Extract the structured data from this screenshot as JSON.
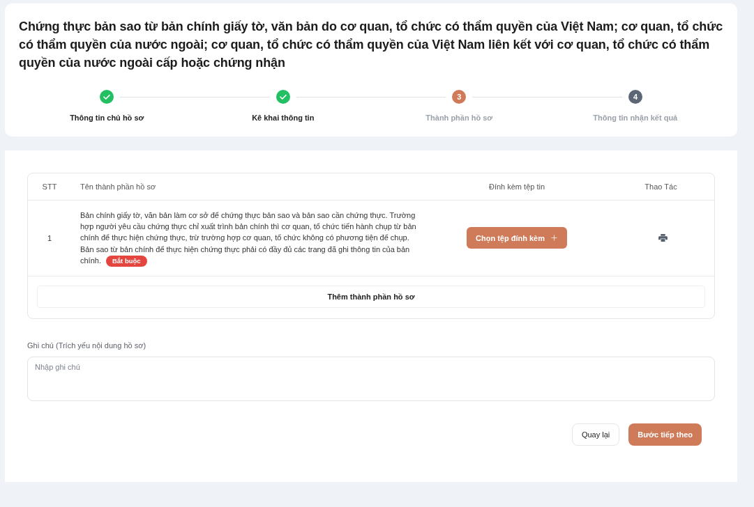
{
  "title": "Chứng thực bản sao từ bản chính giấy tờ, văn bản do cơ quan, tổ chức có thẩm quyền của Việt Nam; cơ quan, tổ chức có thẩm quyền của nước ngoài; cơ quan, tổ chức có thẩm quyền của Việt Nam liên kết với cơ quan, tổ chức có thẩm quyền của nước ngoài cấp hoặc chứng nhận",
  "steps": [
    {
      "label": "Thông tin chủ hồ sơ",
      "done": true,
      "current": false
    },
    {
      "label": "Kê khai thông tin",
      "done": true,
      "current": false
    },
    {
      "label": "Thành phần hồ sơ",
      "done": false,
      "current": true,
      "number": "3"
    },
    {
      "label": "Thông tin nhận kết quả",
      "done": false,
      "current": false,
      "number": "4"
    }
  ],
  "table": {
    "columns": [
      "STT",
      "Tên thành phần hồ sơ",
      "Đính kèm tệp tin",
      "Thao Tác"
    ],
    "rows": [
      {
        "stt": "1",
        "name": "Bản chính giấy tờ, văn bản làm cơ sở để chứng thực bản sao và bản sao cần chứng thực. Trường hợp người yêu cầu chứng thực chỉ xuất trình bản chính thì cơ quan, tổ chức tiến hành chụp từ bản chính để thực hiện chứng thực, trừ trường hợp cơ quan, tổ chức không có phương tiện để chụp. Bản sao từ bản chính để thực hiện chứng thực phải có đầy đủ các trang đã ghi thông tin của bản chính.",
        "badge": "Bắt buộc",
        "attach_button": "Chọn tệp đính kèm"
      }
    ],
    "add_button": "Thêm thành phần hồ sơ"
  },
  "note": {
    "label": "Ghi chú (Trích yếu nội dung hồ sơ)",
    "placeholder": "Nhập ghi chú"
  },
  "buttons": [
    {
      "label": "Quay lại",
      "kind": "secondary"
    },
    {
      "label": "Bước tiếp theo",
      "kind": "primary"
    }
  ]
}
